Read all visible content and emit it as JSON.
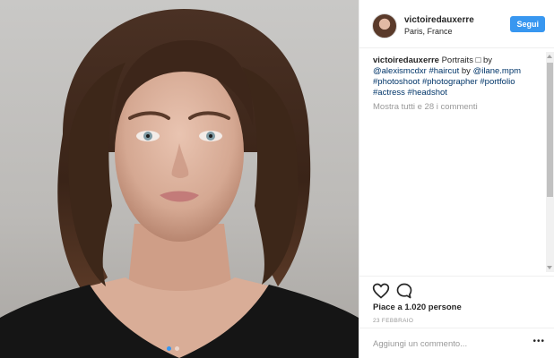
{
  "post": {
    "username": "victoiredauxerre",
    "location": "Paris, France",
    "follow_label": "Segui"
  },
  "caption": {
    "user": "victoiredauxerre",
    "text": "Portraits □ by",
    "mention1": "@alexismcdxr",
    "tag_haircut": "#haircut",
    "by_word": "by",
    "mention2": "@ilane.mpm",
    "tag_photoshoot": "#photoshoot",
    "tag_photographer": "#photographer",
    "tag_portfolio": "#portfolio",
    "tag_actress": "#actress",
    "tag_headshot": "#headshot"
  },
  "comments": {
    "view_all": "Mostra tutti e 28 i commenti",
    "placeholder": "Aggiungi un commento...",
    "more": "•••"
  },
  "engagement": {
    "likes_text": "Piace a 1.020 persone",
    "date": "23 FEBBRAIO"
  },
  "icons": {
    "like": "heart-outline-icon",
    "comment": "comment-bubble-icon",
    "more": "more-options-icon"
  },
  "colors": {
    "accent": "#3897f0",
    "text": "#262626",
    "muted": "#999999",
    "link": "#003569"
  }
}
